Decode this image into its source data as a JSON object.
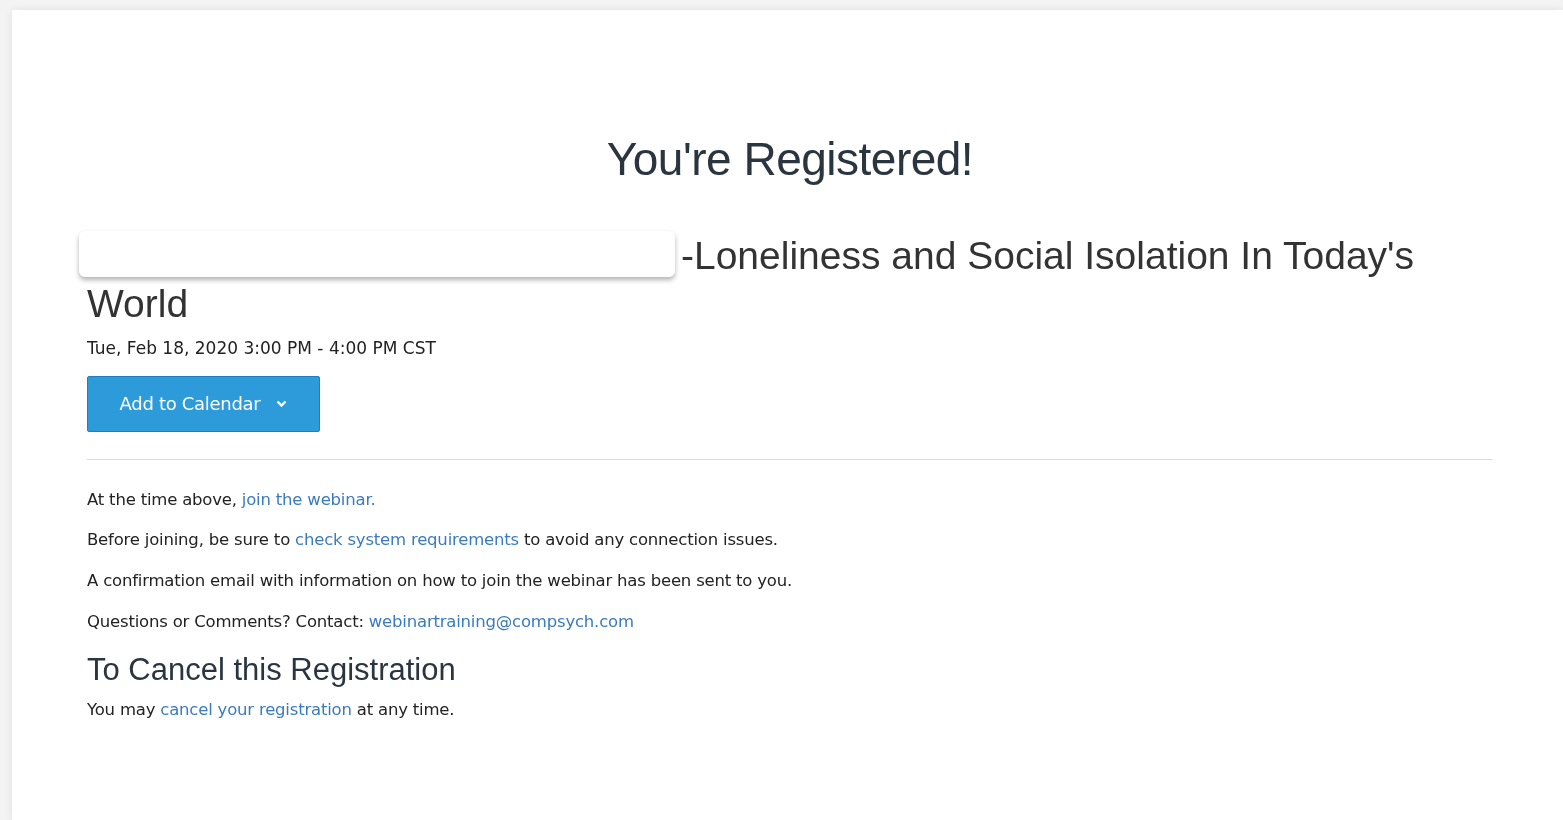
{
  "heading": "You're Registered!",
  "event": {
    "title": "-Loneliness and Social Isolation In Today's World",
    "redacted_prefix": true,
    "datetime": "Tue, Feb 18, 2020 3:00 PM - 4:00 PM CST"
  },
  "calendar_button": {
    "label": "Add to Calendar"
  },
  "paragraphs": [
    [
      {
        "kind": "text",
        "text": "At the time above, "
      },
      {
        "kind": "link",
        "text": "join the webinar."
      }
    ],
    [
      {
        "kind": "text",
        "text": "Before joining, be sure to "
      },
      {
        "kind": "link",
        "text": "check system requirements"
      },
      {
        "kind": "text",
        "text": " to avoid any connection issues."
      }
    ],
    [
      {
        "kind": "text",
        "text": "A confirmation email with information on how to join the webinar has been sent to you."
      }
    ],
    [
      {
        "kind": "text",
        "text": "Questions or Comments? Contact: "
      },
      {
        "kind": "link",
        "text": "webinartraining@compsych.com"
      }
    ]
  ],
  "cancel": {
    "heading": "To Cancel this Registration",
    "paragraph": [
      {
        "kind": "text",
        "text": "You may "
      },
      {
        "kind": "link",
        "text": "cancel your registration"
      },
      {
        "kind": "text",
        "text": " at any time."
      }
    ]
  }
}
